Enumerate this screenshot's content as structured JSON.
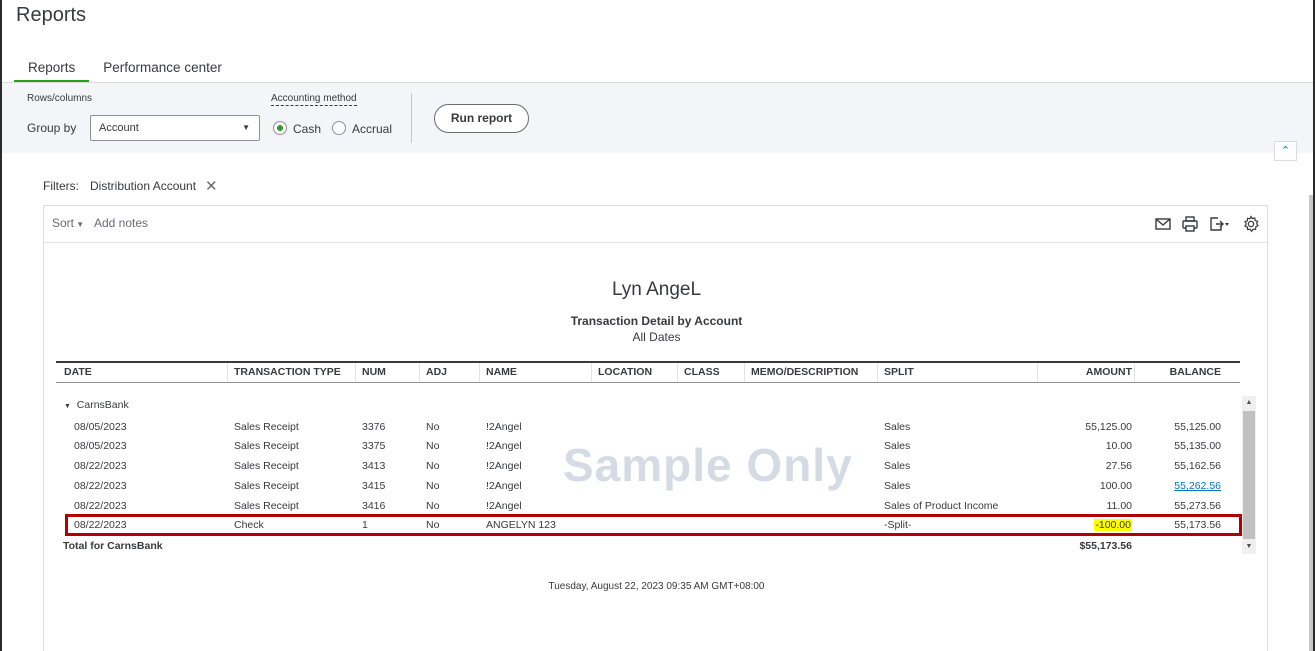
{
  "page": {
    "title": "Reports"
  },
  "tabs": [
    {
      "label": "Reports",
      "active": true
    },
    {
      "label": "Performance center",
      "active": false
    }
  ],
  "toolbar": {
    "rows_columns_label": "Rows/columns",
    "group_by_label": "Group by",
    "group_by_value": "Account",
    "accounting_method_label": "Accounting method",
    "cash_label": "Cash",
    "accrual_label": "Accrual",
    "selected_method": "Cash",
    "run_report_label": "Run report"
  },
  "filters": {
    "label": "Filters:",
    "chips": [
      "Distribution Account"
    ]
  },
  "report_toolbar": {
    "sort_label": "Sort",
    "add_notes_label": "Add notes",
    "icons": [
      "email-icon",
      "print-icon",
      "export-icon",
      "settings-icon"
    ]
  },
  "report": {
    "company": "Lyn AngeL",
    "name": "Transaction Detail by Account",
    "dates": "All Dates",
    "columns": [
      "DATE",
      "TRANSACTION TYPE",
      "NUM",
      "ADJ",
      "NAME",
      "LOCATION",
      "CLASS",
      "MEMO/DESCRIPTION",
      "SPLIT",
      "AMOUNT",
      "BALANCE"
    ],
    "group": "CarnsBank",
    "rows": [
      {
        "date": "08/05/2023",
        "type": "Sales Receipt",
        "num": "3376",
        "adj": "No",
        "name": "!2Angel",
        "split": "Sales",
        "amount": "55,125.00",
        "balance": "55,125.00"
      },
      {
        "date": "08/05/2023",
        "type": "Sales Receipt",
        "num": "3375",
        "adj": "No",
        "name": "!2Angel",
        "split": "Sales",
        "amount": "10.00",
        "balance": "55,135.00"
      },
      {
        "date": "08/22/2023",
        "type": "Sales Receipt",
        "num": "3413",
        "adj": "No",
        "name": "!2Angel",
        "split": "Sales",
        "amount": "27.56",
        "balance": "55,162.56"
      },
      {
        "date": "08/22/2023",
        "type": "Sales Receipt",
        "num": "3415",
        "adj": "No",
        "name": "!2Angel",
        "split": "Sales",
        "amount": "100.00",
        "balance": "55,262.56"
      },
      {
        "date": "08/22/2023",
        "type": "Sales Receipt",
        "num": "3416",
        "adj": "No",
        "name": "!2Angel",
        "split": "Sales of Product Income",
        "amount": "11.00",
        "balance": "55,273.56"
      },
      {
        "date": "08/22/2023",
        "type": "Check",
        "num": "1",
        "adj": "No",
        "name": "ANGELYN 123",
        "split": "-Split-",
        "amount": "-100.00",
        "balance": "55,173.56"
      }
    ],
    "total_label": "Total for CarnsBank",
    "total_amount": "$55,173.56",
    "watermark": "Sample Only",
    "footer_timestamp": "Tuesday, August 22, 2023   09:35 AM GMT+08:00"
  },
  "colors": {
    "accent_green": "#2ca01c",
    "link_blue": "#0077c5",
    "highlight_yellow": "#ffff00",
    "annotation_red": "#b00000"
  }
}
